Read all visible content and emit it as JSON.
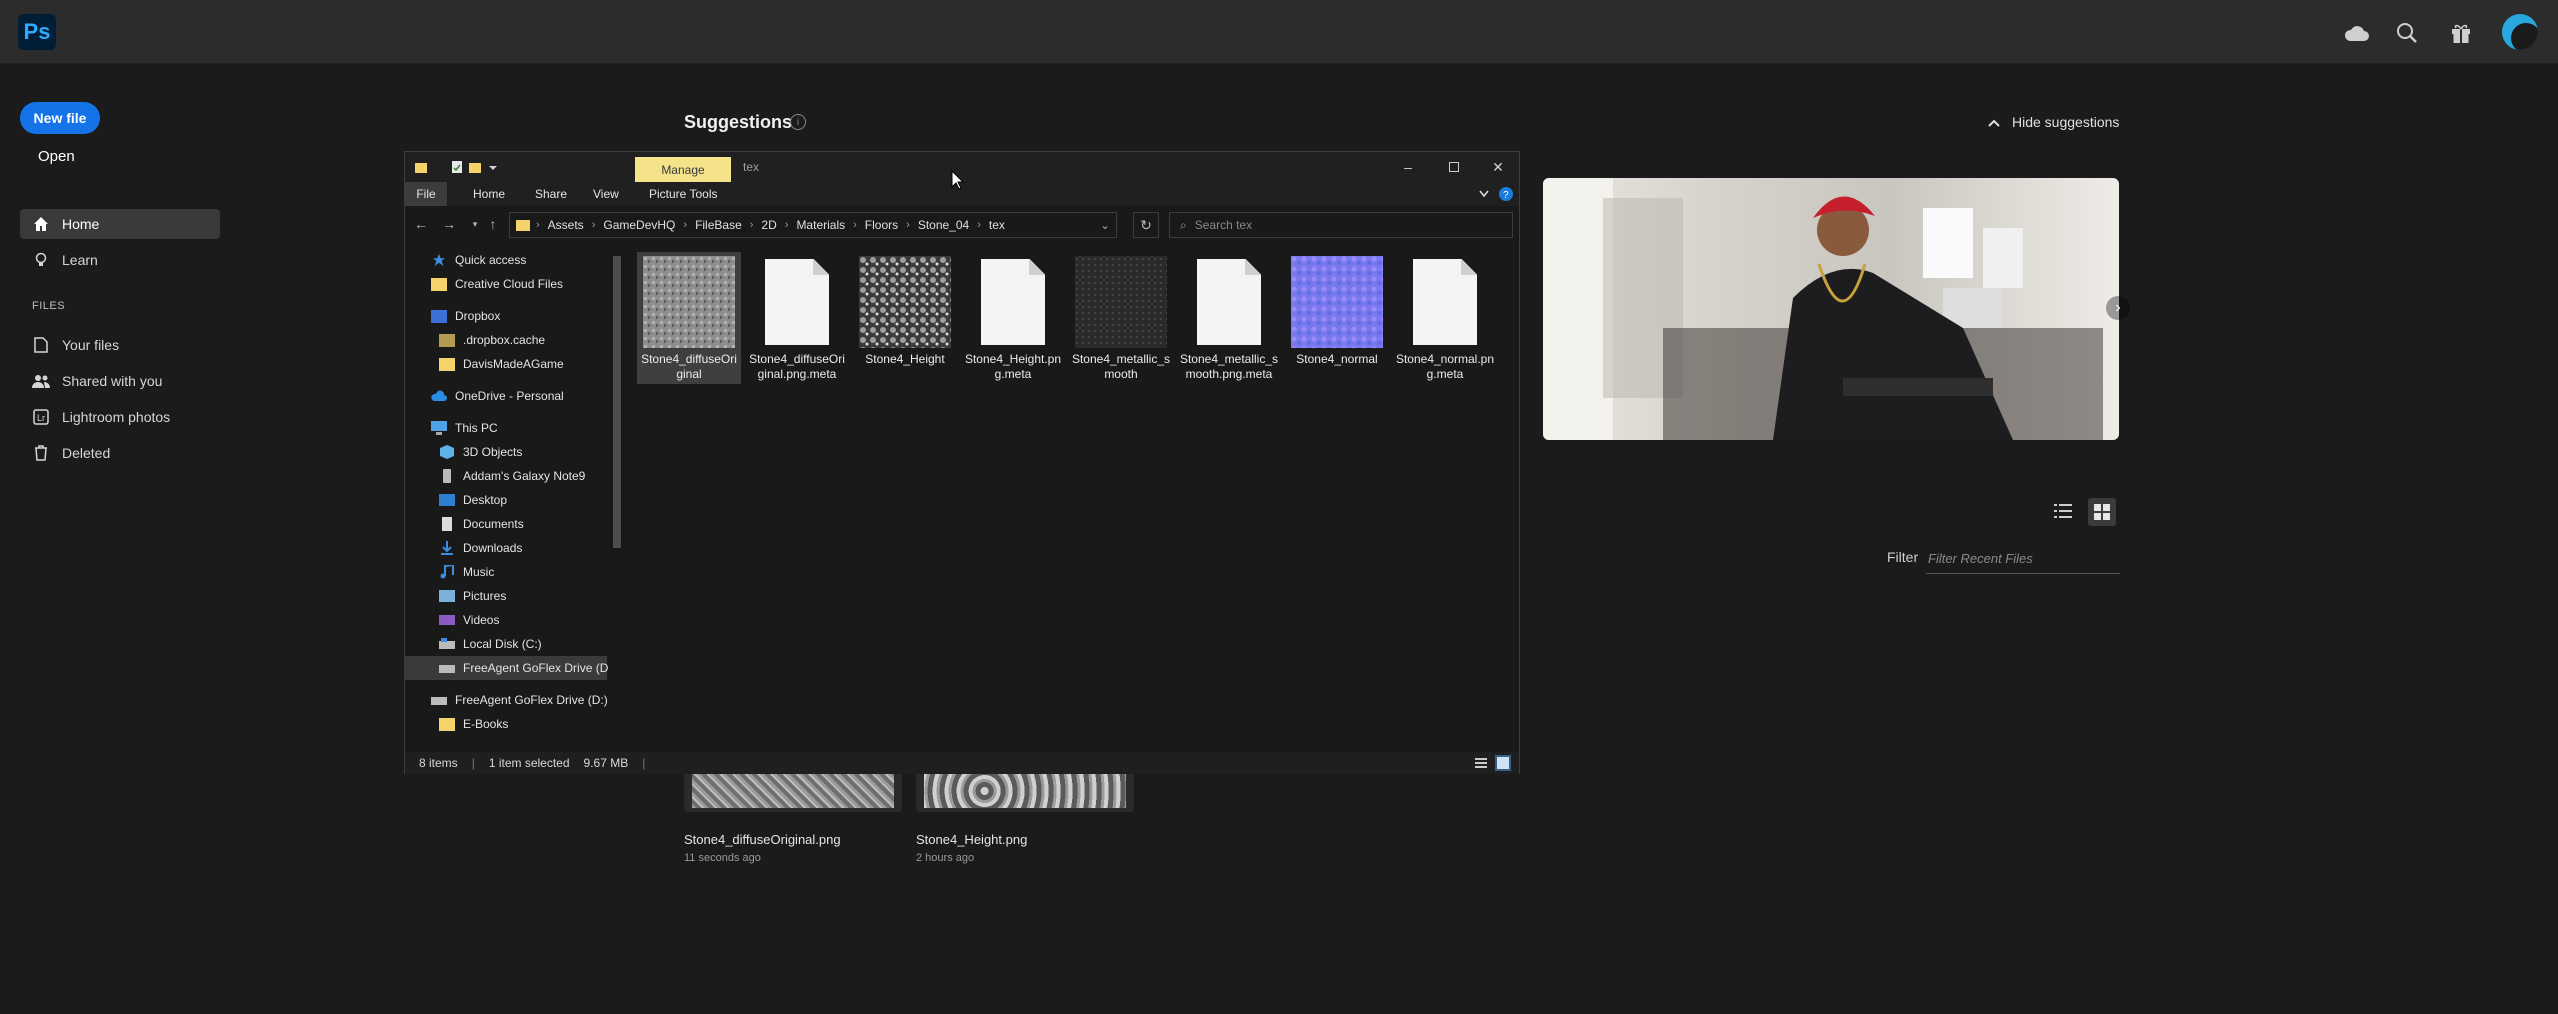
{
  "ps": {
    "logo_text": "Ps",
    "new_file_label": "New file",
    "open_label": "Open",
    "nav": [
      {
        "label": "Home",
        "icon": "home-icon"
      },
      {
        "label": "Learn",
        "icon": "lightbulb-icon"
      }
    ],
    "files_heading": "FILES",
    "files_nav": [
      {
        "label": "Your files",
        "icon": "file-icon"
      },
      {
        "label": "Shared with you",
        "icon": "people-icon"
      },
      {
        "label": "Lightroom photos",
        "icon": "lightroom-icon"
      },
      {
        "label": "Deleted",
        "icon": "trash-icon"
      }
    ],
    "suggestions_title": "Suggestions",
    "hide_suggestions_label": "Hide suggestions",
    "filter_label": "Filter",
    "filter_placeholder": "Filter Recent Files",
    "recent_files": [
      {
        "name": "Stone4_diffuseOriginal.png",
        "time": "11 seconds ago"
      },
      {
        "name": "Stone4_Height.png",
        "time": "2 hours ago"
      }
    ],
    "accent": "#1473e6"
  },
  "explorer": {
    "manage_tab": "Manage",
    "window_title": "tex",
    "ribbon_tabs": [
      "File",
      "Home",
      "Share",
      "View",
      "Picture Tools"
    ],
    "breadcrumb": [
      "Assets",
      "GameDevHQ",
      "FileBase",
      "2D",
      "Materials",
      "Floors",
      "Stone_04",
      "tex"
    ],
    "search_placeholder": "Search tex",
    "nav_items": [
      {
        "label": "Quick access",
        "icon": "star-icon"
      },
      {
        "label": "Creative Cloud Files",
        "icon": "folder-icon"
      },
      {
        "label": "Dropbox",
        "icon": "dropbox-icon"
      },
      {
        "label": ".dropbox.cache",
        "icon": "folder-icon"
      },
      {
        "label": "DavisMadeAGame",
        "icon": "folder-icon"
      },
      {
        "label": "OneDrive - Personal",
        "icon": "cloud-icon"
      },
      {
        "label": "This PC",
        "icon": "computer-icon"
      },
      {
        "label": "3D Objects",
        "icon": "cube-icon"
      },
      {
        "label": "Addam's Galaxy Note9",
        "icon": "phone-icon"
      },
      {
        "label": "Desktop",
        "icon": "desktop-icon"
      },
      {
        "label": "Documents",
        "icon": "documents-icon"
      },
      {
        "label": "Downloads",
        "icon": "download-icon"
      },
      {
        "label": "Music",
        "icon": "music-icon"
      },
      {
        "label": "Pictures",
        "icon": "pictures-icon"
      },
      {
        "label": "Videos",
        "icon": "video-icon"
      },
      {
        "label": "Local Disk (C:)",
        "icon": "disk-icon"
      },
      {
        "label": "FreeAgent GoFlex Drive (D:)",
        "icon": "drive-icon"
      },
      {
        "label": "FreeAgent GoFlex Drive (D:)",
        "icon": "drive-icon"
      },
      {
        "label": "E-Books",
        "icon": "folder-icon"
      }
    ],
    "files": [
      {
        "name": "Stone4_diffuseOriginal",
        "kind": "image",
        "texture": "diffuse"
      },
      {
        "name": "Stone4_diffuseOriginal.png.meta",
        "kind": "doc"
      },
      {
        "name": "Stone4_Height",
        "kind": "image",
        "texture": "height"
      },
      {
        "name": "Stone4_Height.png.meta",
        "kind": "doc"
      },
      {
        "name": "Stone4_metallic_smooth",
        "kind": "image",
        "texture": "metallic"
      },
      {
        "name": "Stone4_metallic_smooth.png.meta",
        "kind": "doc"
      },
      {
        "name": "Stone4_normal",
        "kind": "image",
        "texture": "normal"
      },
      {
        "name": "Stone4_normal.png.meta",
        "kind": "doc"
      }
    ],
    "status_items": "8 items",
    "status_selected": "1 item selected",
    "status_size": "9.67 MB",
    "manage_color": "#f4e38a"
  }
}
